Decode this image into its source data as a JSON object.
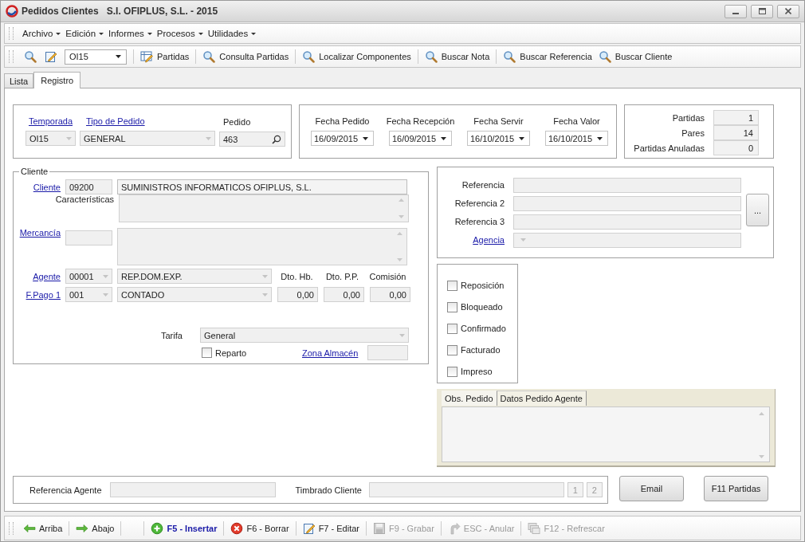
{
  "window": {
    "title": "Pedidos Clientes",
    "subtitle": "S.I. OFIPLUS, S.L. - 2015"
  },
  "menu": [
    {
      "label": "Archivo"
    },
    {
      "label": "Edición"
    },
    {
      "label": "Informes"
    },
    {
      "label": "Procesos"
    },
    {
      "label": "Utilidades"
    }
  ],
  "toolbar": [
    [
      {
        "kind": "search"
      },
      {
        "kind": "edit"
      },
      {
        "kind": "combo",
        "value": "OI15"
      }
    ],
    [
      {
        "kind": "partidas",
        "label": "Partidas"
      }
    ],
    [
      {
        "kind": "search",
        "label": "Consulta Partidas"
      }
    ],
    [
      {
        "kind": "search",
        "label": "Localizar Componentes"
      }
    ],
    [
      {
        "kind": "search",
        "label": "Buscar Nota"
      }
    ],
    [
      {
        "kind": "search",
        "label": "Buscar Referencia"
      },
      {
        "kind": "search",
        "label": "Buscar Cliente"
      }
    ]
  ],
  "tabs": [
    {
      "label": "Lista",
      "selected": false
    },
    {
      "label": "Registro",
      "selected": true
    }
  ],
  "header": {
    "temporada_label": "Temporada",
    "tipo_label": "Tipo de Pedido",
    "pedido_label": "Pedido",
    "temporada": "OI15",
    "tipo": "GENERAL",
    "pedido": "463"
  },
  "dates": [
    {
      "label": "Fecha Pedido",
      "value": "16/09/2015"
    },
    {
      "label": "Fecha Recepción",
      "value": "16/09/2015"
    },
    {
      "label": "Fecha Servir",
      "value": "16/10/2015"
    },
    {
      "label": "Fecha Valor",
      "value": "16/10/2015"
    }
  ],
  "totals": [
    {
      "label": "Partidas",
      "value": "1"
    },
    {
      "label": "Pares",
      "value": "14"
    },
    {
      "label": "Partidas Anuladas",
      "value": "0"
    }
  ],
  "cliente": {
    "legend": "Cliente",
    "cliente_label": "Cliente",
    "cliente_code": "09200",
    "cliente_name": "SUMINISTROS INFORMATICOS OFIPLUS, S.L.",
    "caracteristicas_label": "Características",
    "mercancia_label": "Mercancía",
    "agente_label": "Agente",
    "agente_code": "00001",
    "agente_name": "REP.DOM.EXP.",
    "fpago_label": "F.Pago 1",
    "fpago_code": "001",
    "fpago_name": "CONTADO",
    "discounts": [
      {
        "label": "Dto. Hb.",
        "value": "0,00"
      },
      {
        "label": "Dto. P.P.",
        "value": "0,00"
      },
      {
        "label": "Comisión",
        "value": "0,00"
      }
    ],
    "tarifa_label": "Tarifa",
    "tarifa": "General",
    "reparto": {
      "label": "Reparto",
      "checked": false
    },
    "zona_label": "Zona Almacén"
  },
  "references": [
    {
      "label": "Referencia",
      "kind": "text"
    },
    {
      "label": "Referencia 2",
      "kind": "text"
    },
    {
      "label": "Referencia 3",
      "kind": "text"
    },
    {
      "label": "Agencia",
      "kind": "combo"
    }
  ],
  "references_button": "...",
  "flags": [
    {
      "label": "Reposición",
      "checked": false
    },
    {
      "label": "Bloqueado",
      "checked": false
    },
    {
      "label": "Confirmado",
      "checked": false
    },
    {
      "label": "Facturado",
      "checked": false
    },
    {
      "label": "Impreso",
      "checked": false
    }
  ],
  "obs_tabs": [
    {
      "label": "Obs. Pedido",
      "selected": true
    },
    {
      "label": "Datos Pedido Agente",
      "selected": false
    }
  ],
  "footer": {
    "referencia_agente_label": "Referencia Agente",
    "timbrado_label": "Timbrado Cliente",
    "pages": [
      "1",
      "2"
    ],
    "buttons": [
      "Email",
      "F11 Partidas"
    ]
  },
  "actions": [
    [
      {
        "kind": "up",
        "label": "Arriba",
        "disabled": false,
        "primary": false
      }
    ],
    [
      {
        "kind": "down",
        "label": "Abajo",
        "disabled": false,
        "primary": false
      }
    ],
    [
      {
        "kind": "insert",
        "label": "F5 - Insertar",
        "disabled": false,
        "primary": true
      }
    ],
    [
      {
        "kind": "delete",
        "label": "F6 - Borrar",
        "disabled": false,
        "primary": false
      }
    ],
    [
      {
        "kind": "edit",
        "label": "F7 - Editar",
        "disabled": false,
        "primary": false
      }
    ],
    [
      {
        "kind": "save",
        "label": "F9 - Grabar",
        "disabled": true,
        "primary": false
      }
    ],
    [
      {
        "kind": "cancel",
        "label": "ESC - Anular",
        "disabled": true,
        "primary": false
      }
    ],
    [
      {
        "kind": "refresh",
        "label": "F12 - Refrescar",
        "disabled": true,
        "primary": false
      }
    ]
  ]
}
